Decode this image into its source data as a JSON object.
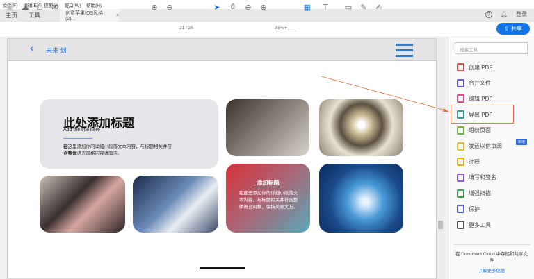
{
  "menu": [
    "文件(F)",
    "编辑(E)",
    "视图(V)",
    "窗口(W)",
    "帮助(H)"
  ],
  "tabs": {
    "home": "主页",
    "tools": "工具",
    "doc": "创意苹果IOS风格(2)...",
    "close": "×"
  },
  "topright": {
    "help": "?",
    "login": "登录"
  },
  "toolbar": {
    "page_current": "21",
    "page_total": "/ 25",
    "zoom": "85%",
    "share": "共享"
  },
  "page": {
    "brand": "未来 划",
    "card_title": "此处添加标题",
    "card_subtitle": "Add the title here",
    "card_text_bold": "在",
    "card_text": "这里添加你的详细小段落文本内容，与标题相关并符",
    "card_text2_bold": "合整体",
    "card_text2": "语言风格内容请简洁。",
    "red_title": "添加标题",
    "red_text": "在这里添加你的详细小段落文本内容，与标题相关并符合整体语言风格，保持美观大方。"
  },
  "panel": {
    "search_placeholder": "搜索工具",
    "tools": [
      {
        "label": "创建 PDF",
        "color": "#e0504a"
      },
      {
        "label": "合并文件",
        "color": "#5b5bd6"
      },
      {
        "label": "编辑 PDF",
        "color": "#d84a8a"
      },
      {
        "label": "导出 PDF",
        "color": "#2a9a9a"
      },
      {
        "label": "组织页面",
        "color": "#6ab04a"
      },
      {
        "label": "发送以供审阅",
        "color": "#e8c020"
      },
      {
        "label": "注释",
        "color": "#e8b020"
      },
      {
        "label": "填写和签名",
        "color": "#8a5ad6"
      },
      {
        "label": "增强扫描",
        "color": "#3aa04a"
      },
      {
        "label": "保护",
        "color": "#4a60c8"
      },
      {
        "label": "更多工具",
        "color": "#555555"
      }
    ],
    "new_badge": "新增",
    "cloud_text": "在 Document Cloud 中存储和共享文件",
    "learn_more": "了解更多信息"
  },
  "highlight_color": "#e8704a"
}
